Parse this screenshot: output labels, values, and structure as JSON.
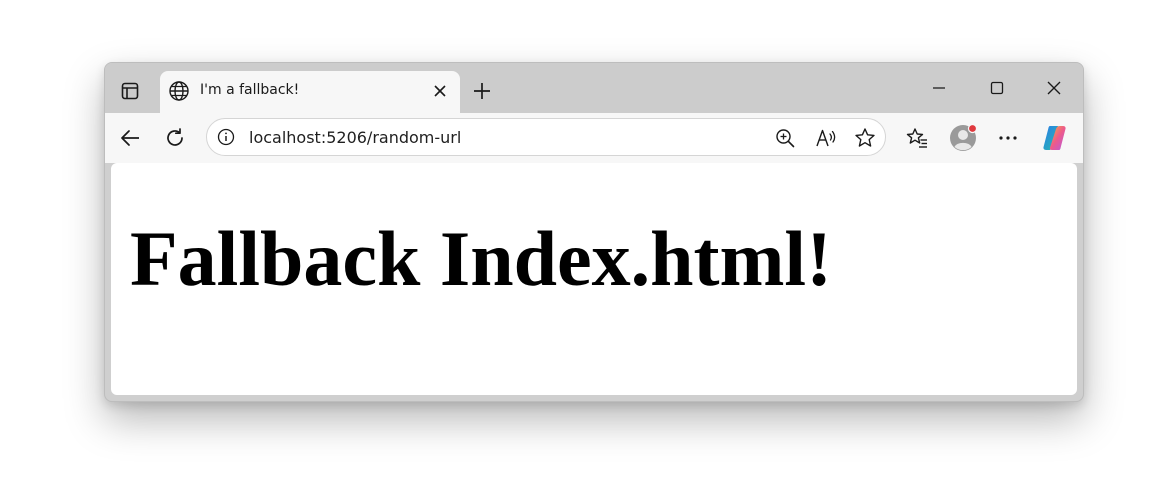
{
  "tab": {
    "title": "I'm a fallback!"
  },
  "address_bar": {
    "url": "localhost:5206/random-url"
  },
  "page": {
    "heading": "Fallback Index.html!"
  },
  "colors": {
    "tabstrip": "#cccccc",
    "toolbar": "#f7f7f7",
    "profile_badge": "#e0393e"
  },
  "icons": {
    "tab_actions": "tab-actions-icon",
    "favicon": "globe-icon",
    "tab_close": "close-icon",
    "new_tab": "plus-icon",
    "minimize": "minimize-icon",
    "maximize": "maximize-icon",
    "close_window": "close-icon",
    "back": "back-arrow-icon",
    "refresh": "refresh-icon",
    "site_info": "info-icon",
    "zoom": "zoom-icon",
    "read_aloud": "read-aloud-icon",
    "favorite": "star-icon",
    "favorites": "favorites-icon",
    "profile": "avatar",
    "more": "more-icon",
    "copilot": "copilot-icon"
  }
}
